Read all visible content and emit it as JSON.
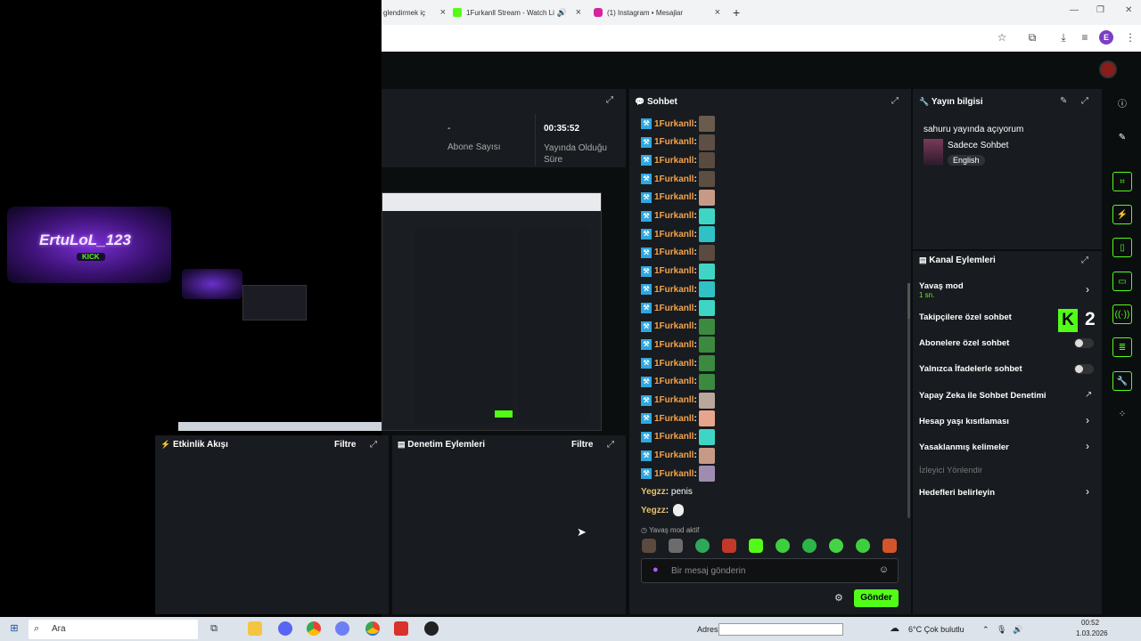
{
  "browser": {
    "tabs": [
      {
        "label": "glendirmek iç",
        "color": "#e9e9e9"
      },
      {
        "label": "1Furkanll Stream - Watch Li",
        "color": "#53fc18"
      },
      {
        "label": "(1) Instagram • Mesajlar",
        "color": "#d6249f"
      }
    ],
    "tab_close": "×",
    "new_tab": "+",
    "profile_initial": "E"
  },
  "stats": {
    "sub_value": "-",
    "sub_label": "Abone Sayısı",
    "time_value": "00:35:52",
    "time_label": "Yayında Olduğu Süre"
  },
  "chat": {
    "title": "Sohbet",
    "messages": [
      {
        "user": "1Furkanll",
        "emote_color": "#6b5b4d"
      },
      {
        "user": "1Furkanll",
        "emote_color": "#5e4f44"
      },
      {
        "user": "1Furkanll",
        "emote_color": "#5a4a40"
      },
      {
        "user": "1Furkanll",
        "emote_color": "#5d4e42"
      },
      {
        "user": "1Furkanll",
        "emote_color": "#c79a86"
      },
      {
        "user": "1Furkanll",
        "emote_color": "#3fd5c4"
      },
      {
        "user": "1Furkanll",
        "emote_color": "#2fc1c4"
      },
      {
        "user": "1Furkanll",
        "emote_color": "#5a4a40"
      },
      {
        "user": "1Furkanll",
        "emote_color": "#3fd5c4"
      },
      {
        "user": "1Furkanll",
        "emote_color": "#2fc1c4"
      },
      {
        "user": "1Furkanll",
        "emote_color": "#3fd5c4"
      },
      {
        "user": "1Furkanll",
        "emote_color": "#3b8a3f"
      },
      {
        "user": "1Furkanll",
        "emote_color": "#3b8a3f"
      },
      {
        "user": "1Furkanll",
        "emote_color": "#3b8a3f"
      },
      {
        "user": "1Furkanll",
        "emote_color": "#3b8a3f"
      },
      {
        "user": "1Furkanll",
        "emote_color": "#b8a79a"
      },
      {
        "user": "1Furkanll",
        "emote_color": "#e6a58c"
      },
      {
        "user": "1Furkanll",
        "emote_color": "#3fd5c4"
      },
      {
        "user": "1Furkanll",
        "emote_color": "#c79a86"
      },
      {
        "user": "1Furkanll",
        "emote_color": "#a08cb0"
      }
    ],
    "yegzz1_user": "Yegzz",
    "yegzz1_text": "penis",
    "yegzz2_user": "Yegzz",
    "slow_notice": "Yavaş mod aktif",
    "input_placeholder": "Bir mesaj gönderin",
    "send_label": "Gönder"
  },
  "stream_info": {
    "title": "Yayın bilgisi",
    "stream_title": "sahuru yayında açıyorum",
    "category": "Sadece Sohbet",
    "language": "English"
  },
  "channel_actions": {
    "title": "Kanal Eylemleri",
    "slow_mode": "Yavaş mod",
    "slow_mode_value": "1 sn.",
    "followers_only": "Takipçilere özel sohbet",
    "subs_only": "Abonelere özel sohbet",
    "emotes_only": "Yalnızca İfadelerle sohbet",
    "ai_moderation": "Yapay Zeka ile Sohbet Denetimi",
    "account_age": "Hesap yaşı kısıtlaması",
    "banned_words": "Yasaklanmış kelimeler",
    "raid": "İzleyici Yönlendir",
    "goals": "Hedefleri belirleyin",
    "kick_number": "2"
  },
  "activity": {
    "title": "Etkinlik Akışı",
    "filter": "Filtre"
  },
  "moderation": {
    "title": "Denetim Eylemleri",
    "filter": "Filtre"
  },
  "overlay": {
    "name": "ErtuLoL_123",
    "kick": "KICK"
  },
  "taskbar": {
    "search": "Ara",
    "address_label": "Adres",
    "weather": "6°C  Çok bulutlu",
    "time": "00:52",
    "date": "1.03.2026"
  }
}
